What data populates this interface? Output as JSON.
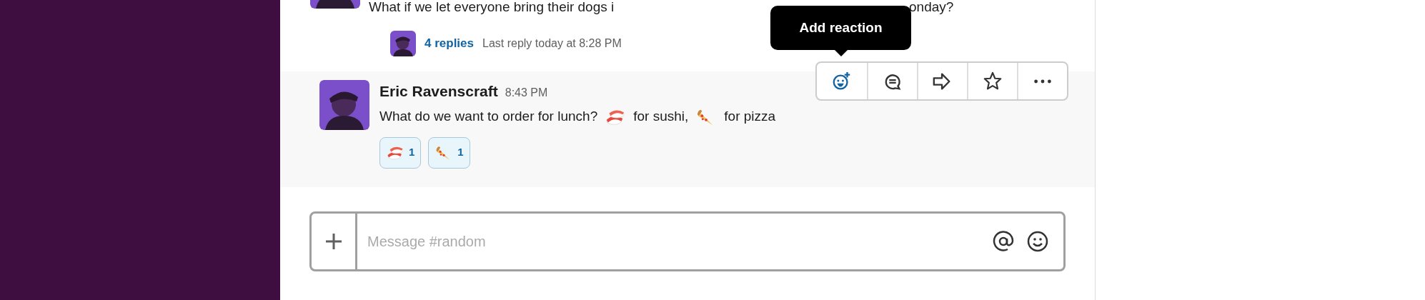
{
  "thread_message": {
    "text_start": "What if we let everyone bring their dogs i",
    "text_end": "onday?",
    "replies": "4 replies",
    "last_reply": "Last reply today at 8:28 PM"
  },
  "tooltip": "Add reaction",
  "message": {
    "author": "Eric Ravenscraft",
    "time": "8:43 PM",
    "parts": [
      {
        "kind": "text",
        "text": "What do we want to order for lunch?"
      },
      {
        "kind": "sushi"
      },
      {
        "kind": "text",
        "text": "for sushi,"
      },
      {
        "kind": "pizza"
      },
      {
        "kind": "text",
        "text": "for pizza"
      }
    ],
    "reactions": [
      {
        "kind": "sushi",
        "count": "1",
        "selected": true
      },
      {
        "kind": "pizza",
        "count": "1",
        "selected": true
      }
    ]
  },
  "actions": [
    {
      "kind": "reaction"
    },
    {
      "kind": "thread"
    },
    {
      "kind": "share"
    },
    {
      "kind": "star"
    },
    {
      "kind": "more"
    }
  ],
  "composer": {
    "placeholder": "Message #random"
  }
}
